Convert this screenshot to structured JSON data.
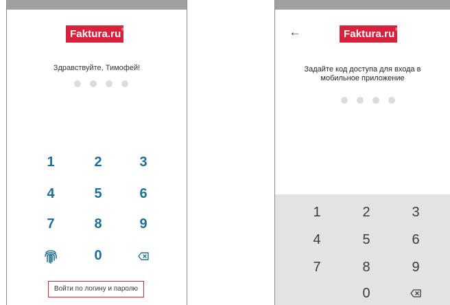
{
  "colors": {
    "brand": "#d8223c",
    "key_blue": "#1e6e97",
    "dot_empty": "#dcdcdc",
    "keyboard_bg": "#e3e3e3"
  },
  "left_screen": {
    "logo": "Faktura.ru",
    "logo_mark": "®",
    "greeting": "Здравствуйте, Тимофей!",
    "pin_dots": 4,
    "keypad": [
      "1",
      "2",
      "3",
      "4",
      "5",
      "6",
      "7",
      "8",
      "9",
      "0"
    ],
    "fingerprint_icon": "fingerprint-icon",
    "backspace_icon": "backspace-icon",
    "login_link": "Войти по логину и паролю"
  },
  "right_screen": {
    "back_icon": "back-arrow-icon",
    "logo": "Faktura.ru",
    "logo_mark": "®",
    "instruction": "Задайте код доступа для входа в мобильное приложение",
    "pin_dots": 4,
    "keyboard": [
      "1",
      "2",
      "3",
      "4",
      "5",
      "6",
      "7",
      "8",
      "9",
      "0"
    ],
    "backspace_icon": "backspace-icon"
  }
}
